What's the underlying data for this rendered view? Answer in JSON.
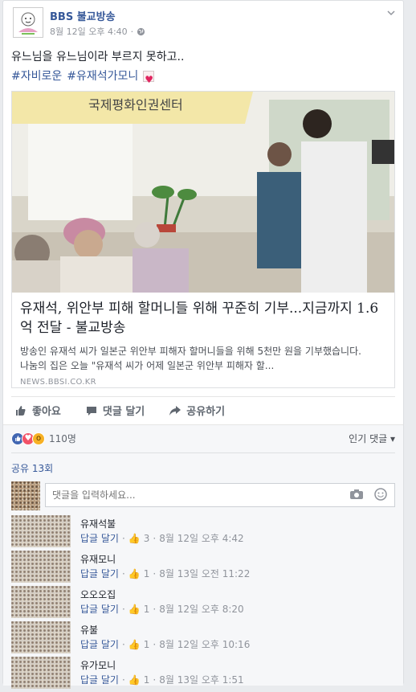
{
  "post": {
    "page_name": "BBS 불교방송",
    "date": "8월 12일 오후 4:40",
    "text": "유느님을 유느님이라 부르지 못하고..",
    "tags": [
      "#자비로운",
      "#유재석가모니"
    ],
    "link": {
      "title": "유재석, 위안부 피해 할머니들 위해 꾸준히 기부...지금까지 1.6억 전달 - 불교방송",
      "description_line1": "방송인 유재석 씨가 일본군 위안부 피해자 할머니들을 위해 5천만 원을 기부했습니다.",
      "description_line2": "나눔의 집은 오늘 \"유재석 씨가 어제 일본군 위안부 피해자 할...",
      "source": "NEWS.BBSI.CO.KR",
      "photo_banner": "국제평화인권센터"
    }
  },
  "actions": {
    "like": "좋아요",
    "comment": "댓글 달기",
    "share": "공유하기"
  },
  "reactions": {
    "count": "110명",
    "sort_label": "인기 댓글"
  },
  "shares": "공유 13회",
  "composer": {
    "placeholder": "댓글을 입력하세요..."
  },
  "comments": [
    {
      "name": "유재석불",
      "reply": "답글 달기",
      "likes": "3",
      "time": "8월 12일 오후 4:42"
    },
    {
      "name": "유재모니",
      "reply": "답글 달기",
      "likes": "1",
      "time": "8월 13일 오전 11:22"
    },
    {
      "name": "오오오집",
      "reply": "답글 달기",
      "likes": "1",
      "time": "8월 12일 오후 8:20"
    },
    {
      "name": "유불",
      "reply": "답글 달기",
      "likes": "1",
      "time": "8월 12일 오후 10:16"
    },
    {
      "name": "유가모니",
      "reply": "답글 달기",
      "likes": "1",
      "time": "8월 13일 오후 1:51"
    }
  ],
  "icons": [
    "globe-icon",
    "chevron-down-icon",
    "like-icon",
    "comment-icon",
    "share-icon",
    "camera-icon",
    "smiley-icon",
    "heart-emoji-icon"
  ],
  "colors": {
    "link_blue": "#365899",
    "like_blue": "#4267b2",
    "love_red": "#f25268",
    "wow_yellow": "#f7b125"
  }
}
